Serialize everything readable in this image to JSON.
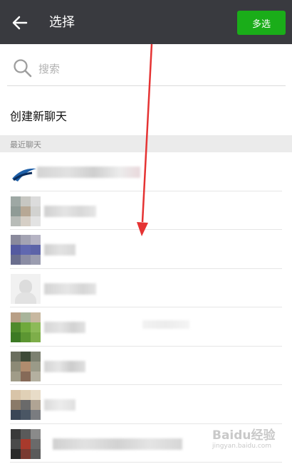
{
  "header": {
    "title": "选择",
    "back_icon": "arrow-left-icon",
    "multi_select_label": "多选",
    "background_color": "#393a3f",
    "button_color": "#1aad19"
  },
  "search": {
    "placeholder": "搜索",
    "icon": "search-icon"
  },
  "new_chat_label": "创建新聊天",
  "recent_header": "最近聊天",
  "watermark": {
    "text": "Baidu经验",
    "url": "jingyan.baidu.com"
  }
}
